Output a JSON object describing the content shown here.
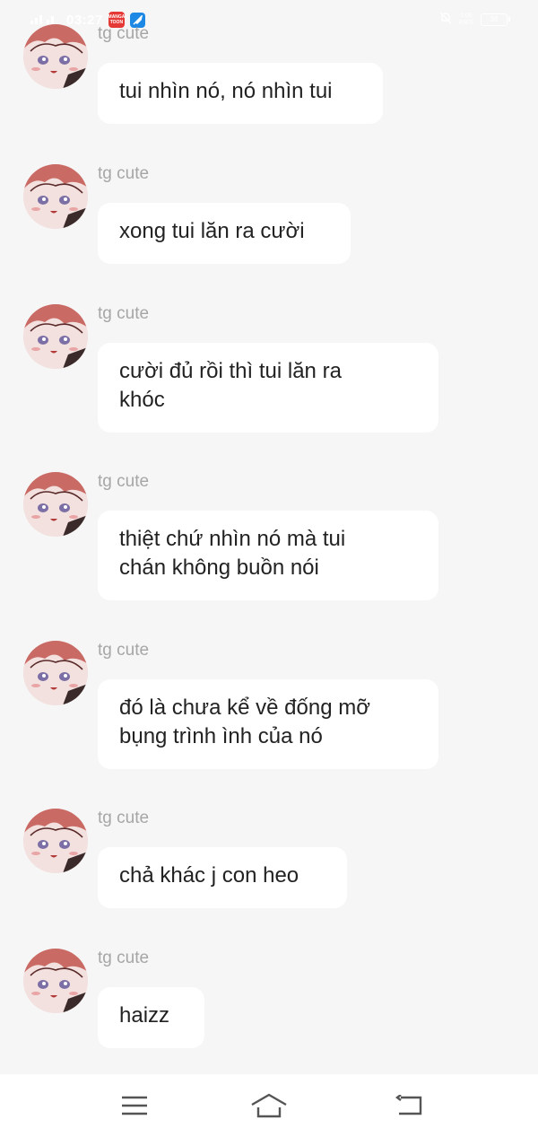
{
  "status_bar": {
    "time": "03:27",
    "signal_icon": "signal-icon",
    "app_badge_text": "MANGA TOON",
    "net_speed_value": "0.00",
    "net_speed_unit": "KB/S",
    "battery": "38"
  },
  "messages": [
    {
      "sender": "tg cute",
      "lines": [
        "tui nhìn nó, nó nhìn tui"
      ]
    },
    {
      "sender": "tg cute",
      "lines": [
        "xong tui lăn ra cười"
      ]
    },
    {
      "sender": "tg cute",
      "lines": [
        "cười đủ rồi thì tui lăn ra",
        "khóc"
      ]
    },
    {
      "sender": "tg cute",
      "lines": [
        "thiệt chứ nhìn nó mà tui",
        "chán không buồn nói"
      ]
    },
    {
      "sender": "tg cute",
      "lines": [
        "đó là chưa kể về đống mỡ",
        "bụng trình ình của nó"
      ]
    },
    {
      "sender": "tg cute",
      "lines": [
        "chả khác j con heo"
      ]
    },
    {
      "sender": "tg cute",
      "lines": [
        "haizz"
      ]
    }
  ],
  "nav_bar": {
    "menu_icon": "menu-icon",
    "home_icon": "home-icon",
    "back_icon": "back-icon"
  },
  "colors": {
    "background": "#f6f6f6",
    "bubble": "#ffffff",
    "sender_text": "#a6a6a6",
    "message_text": "#222222",
    "avatar_hair": "#c96a64"
  }
}
